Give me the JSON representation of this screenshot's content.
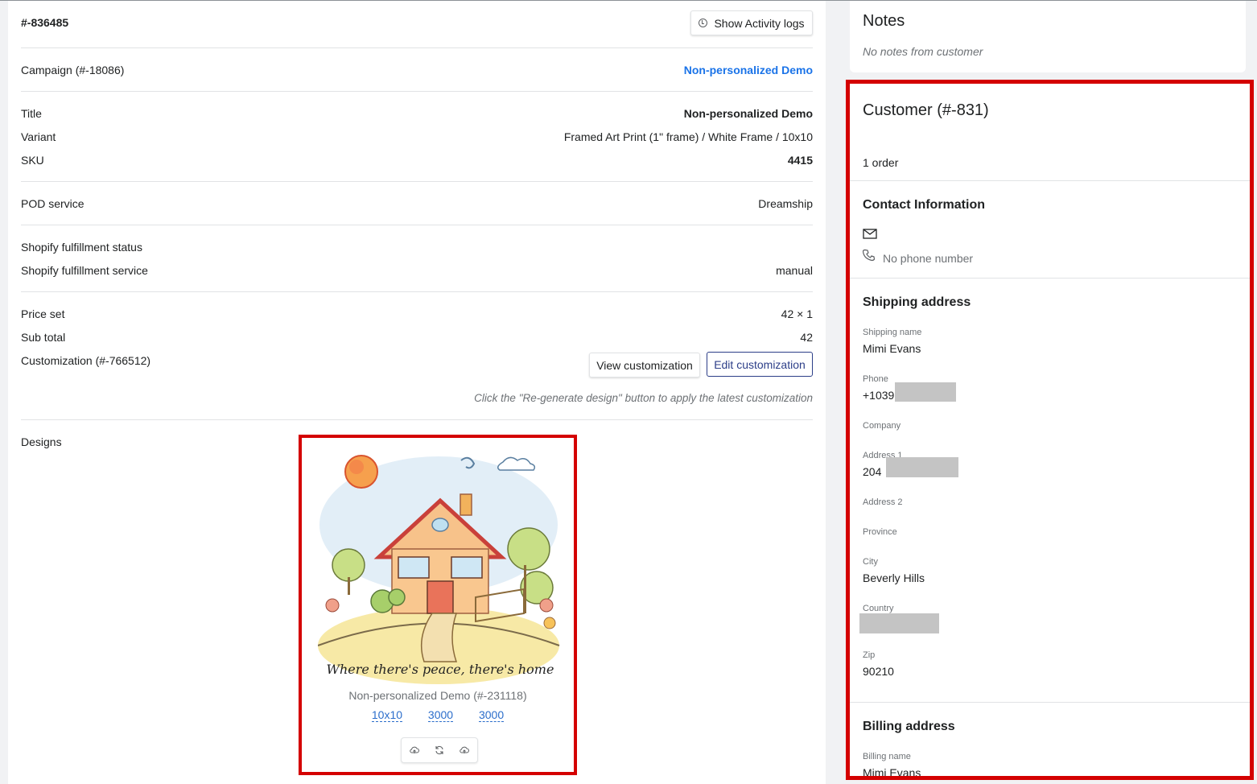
{
  "order": {
    "id": "#-836485",
    "activity_button": "Show Activity logs",
    "campaign_label": "Campaign (#-18086)",
    "campaign_link": "Non-personalized Demo",
    "title_label": "Title",
    "title_value": "Non-personalized Demo",
    "variant_label": "Variant",
    "variant_value": "Framed Art Print (1\" frame) / White Frame / 10x10",
    "sku_label": "SKU",
    "sku_value": "4415",
    "pod_label": "POD service",
    "pod_value": "Dreamship",
    "fulfillment_status_label": "Shopify fulfillment status",
    "fulfillment_service_label": "Shopify fulfillment service",
    "fulfillment_service_value": "manual",
    "price_label": "Price set",
    "price_value": "42 × 1",
    "subtotal_label": "Sub total",
    "subtotal_value": "42",
    "customization_label": "Customization (#-766512)",
    "view_customization": "View customization",
    "edit_customization": "Edit customization",
    "regen_hint": "Click the \"Re-generate design\" button to apply the latest customization",
    "designs_label": "Designs"
  },
  "design": {
    "caption_art": "Where there's peace, there's home",
    "name": "Non-personalized Demo (#-231118)",
    "dims": [
      "10x10",
      "3000",
      "3000"
    ],
    "icons": [
      "upload-cloud-icon",
      "refresh-icon",
      "upload-cloud-icon"
    ]
  },
  "notes": {
    "title": "Notes",
    "text": "No notes from customer"
  },
  "customer": {
    "title": "Customer (#-831)",
    "orders": "1 order",
    "contact_title": "Contact Information",
    "phone_text": "No phone number",
    "shipping_title": "Shipping address",
    "shipping_name_label": "Shipping name",
    "shipping_name": "Mimi Evans",
    "phone_label": "Phone",
    "phone_value": "+1039",
    "company_label": "Company",
    "address1_label": "Address 1",
    "address1_value": "204",
    "address2_label": "Address 2",
    "province_label": "Province",
    "city_label": "City",
    "city_value": "Beverly Hills",
    "country_label": "Country",
    "zip_label": "Zip",
    "zip_value": "90210",
    "billing_title": "Billing address",
    "billing_name_label": "Billing name",
    "billing_name": "Mimi Evans"
  },
  "colors": {
    "accent_link": "#1a73e8",
    "highlight_border": "#d40000",
    "button_outline": "#2c3e88"
  }
}
